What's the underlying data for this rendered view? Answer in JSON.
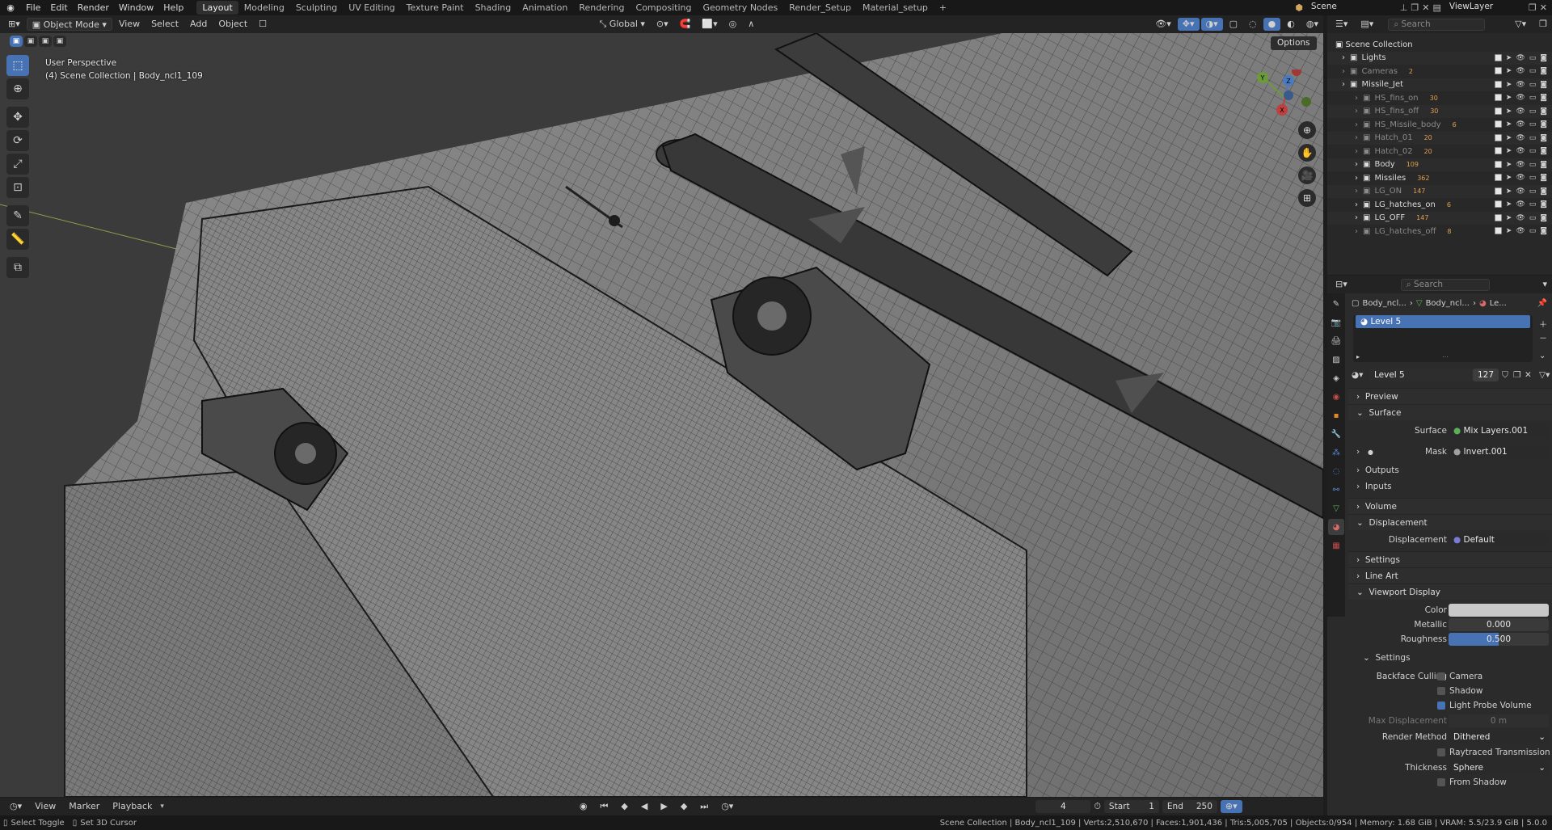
{
  "topbar": {
    "menus": [
      "File",
      "Edit",
      "Render",
      "Window",
      "Help"
    ],
    "workspaces": [
      "Layout",
      "Modeling",
      "Sculpting",
      "UV Editing",
      "Texture Paint",
      "Shading",
      "Animation",
      "Rendering",
      "Compositing",
      "Geometry Nodes",
      "Render_Setup",
      "Material_setup"
    ],
    "active_workspace": "Layout",
    "add_tab": "+",
    "scene": "Scene",
    "view_layer": "ViewLayer"
  },
  "viewport_header": {
    "mode": "Object Mode",
    "menus": [
      "View",
      "Select",
      "Add",
      "Object"
    ],
    "orientation": "Global"
  },
  "viewport": {
    "perspective": "User Perspective",
    "collection_info": "(4) Scene Collection | Body_ncl1_109",
    "options": "Options"
  },
  "timeline": {
    "menus": [
      "View",
      "Marker",
      "Playback"
    ],
    "current_frame": "4",
    "start_label": "Start",
    "start": "1",
    "end_label": "End",
    "end": "250"
  },
  "statusbar": {
    "left_select": "Select Toggle",
    "left_cursor": "Set 3D Cursor",
    "stats": "Scene Collection | Body_ncl1_109 | Verts:2,510,670 | Faces:1,901,436 | Tris:5,005,705 | Objects:0/954 | Memory: 1.68 GiB | VRAM: 5.5/23.9 GiB | 5.0.0"
  },
  "outliner": {
    "search_placeholder": "Search",
    "root": "Scene Collection",
    "items": [
      {
        "name": "Lights",
        "badge": "",
        "depth": 1,
        "dim": false
      },
      {
        "name": "Cameras",
        "badge": "2",
        "depth": 1,
        "dim": true
      },
      {
        "name": "Missile_Jet",
        "badge": "",
        "depth": 1,
        "dim": false
      },
      {
        "name": "HS_fins_on",
        "badge": "30",
        "depth": 2,
        "dim": true
      },
      {
        "name": "HS_fins_off",
        "badge": "30",
        "depth": 2,
        "dim": true
      },
      {
        "name": "HS_Missile_body",
        "badge": "6",
        "depth": 2,
        "dim": true
      },
      {
        "name": "Hatch_01",
        "badge": "20",
        "depth": 2,
        "dim": true
      },
      {
        "name": "Hatch_02",
        "badge": "20",
        "depth": 2,
        "dim": true
      },
      {
        "name": "Body",
        "badge": "109",
        "depth": 2,
        "dim": false
      },
      {
        "name": "Missiles",
        "badge": "362",
        "depth": 2,
        "dim": false
      },
      {
        "name": "LG_ON",
        "badge": "147",
        "depth": 2,
        "dim": true
      },
      {
        "name": "LG_hatches_on",
        "badge": "6",
        "depth": 2,
        "dim": false
      },
      {
        "name": "LG_OFF",
        "badge": "147",
        "depth": 2,
        "dim": false
      },
      {
        "name": "LG_hatches_off",
        "badge": "8",
        "depth": 2,
        "dim": true
      }
    ]
  },
  "properties": {
    "search_placeholder": "Search",
    "breadcrumb": [
      "Body_ncl...",
      "Body_ncl...",
      "Le..."
    ],
    "material_slot": "Level 5",
    "material_name": "Level 5",
    "material_users": "127",
    "panels": {
      "preview": "Preview",
      "surface": "Surface",
      "volume": "Volume",
      "displacement": "Displacement",
      "settings": "Settings",
      "line_art": "Line Art",
      "viewport_display": "Viewport Display",
      "vd_settings": "Settings"
    },
    "surface": {
      "surface_label": "Surface",
      "surface_value": "Mix Layers.001",
      "mask_label": "Mask",
      "mask_value": "Invert.001",
      "outputs": "Outputs",
      "inputs": "Inputs"
    },
    "displacement": {
      "label": "Displacement",
      "value": "Default"
    },
    "viewport_display": {
      "color_label": "Color",
      "metallic_label": "Metallic",
      "metallic": "0.000",
      "roughness_label": "Roughness",
      "roughness": "0.500",
      "roughness_fraction": 0.5
    },
    "vd_settings": {
      "backface_label": "Backface Culling",
      "camera": "Camera",
      "shadow": "Shadow",
      "light_probe": "Light Probe Volume",
      "max_disp_label": "Max Displacement",
      "max_disp": "0 m",
      "render_method_label": "Render Method",
      "render_method": "Dithered",
      "raytraced": "Raytraced Transmission",
      "thickness_label": "Thickness",
      "thickness": "Sphere",
      "from_shadow": "From Shadow"
    }
  },
  "colors": {
    "accent": "#4772b3",
    "bg": "#1d1d1d",
    "viewport": "#3a3a3a"
  }
}
